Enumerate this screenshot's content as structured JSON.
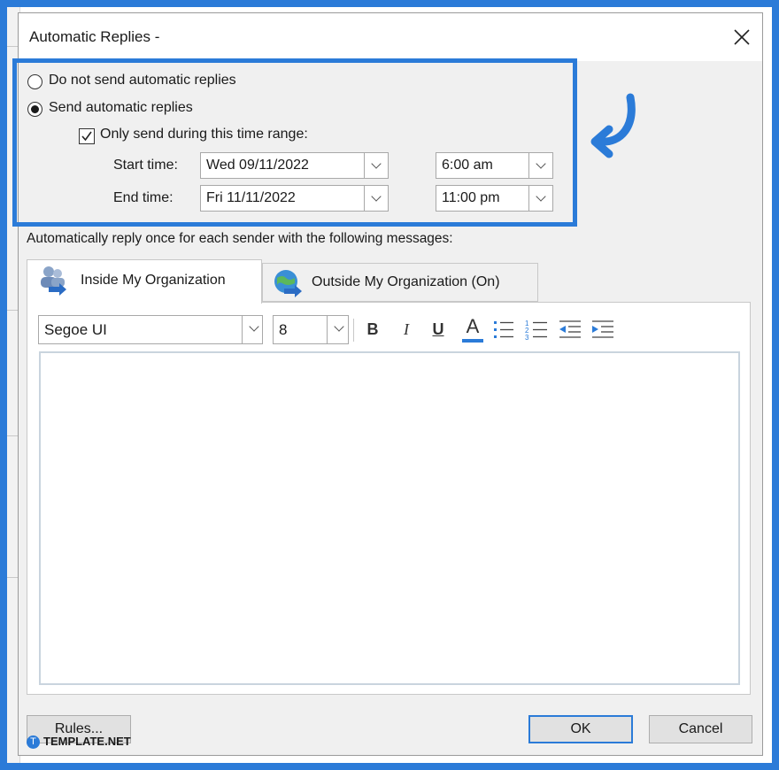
{
  "dialog": {
    "title": "Automatic Replies -",
    "close_label": "Close"
  },
  "options": {
    "no_replies_label": "Do not send automatic replies",
    "no_replies_selected": false,
    "send_replies_label": "Send automatic replies",
    "send_replies_selected": true,
    "time_range_label": "Only send during this time range:",
    "time_range_checked": true,
    "start_label": "Start time:",
    "start_date": "Wed 09/11/2022",
    "start_time": "6:00 am",
    "end_label": "End time:",
    "end_date": "Fri 11/11/2022",
    "end_time": "11:00 pm"
  },
  "messages": {
    "instruction": "Automatically reply once for each sender with the following messages:",
    "tabs": [
      {
        "label": "Inside My Organization",
        "active": true
      },
      {
        "label": "Outside My Organization (On)",
        "active": false
      }
    ]
  },
  "toolbar": {
    "font_name": "Segoe UI",
    "font_size": "8",
    "bold": "B",
    "italic": "I",
    "underline": "U",
    "font_color": "A"
  },
  "footer": {
    "rules_label": "Rules...",
    "ok_label": "OK",
    "cancel_label": "Cancel"
  },
  "watermark": {
    "logo": "T",
    "text": "TEMPLATE.NET"
  },
  "colors": {
    "accent": "#2b7bd8",
    "dialog_bg": "#f0f0f0"
  }
}
